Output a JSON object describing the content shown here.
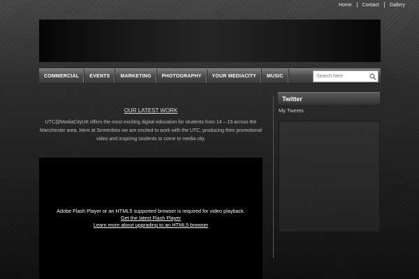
{
  "top_nav": {
    "home": "Home",
    "contact": "Contact",
    "gallery": "Gallery"
  },
  "main_nav": [
    "COMMERCIAL",
    "EVENTS",
    "MARKETING",
    "PHOTOGRAPHY",
    "YOUR MEDIACITY",
    "MUSIC"
  ],
  "search": {
    "placeholder": "Search here",
    "icon": "search-icon"
  },
  "content": {
    "heading": "OUR LATEST WORK",
    "body": "UTC@MediaCityUK offers the most exciting digital education for students from 14 – 19 across the Manchester area. Here at Screenboo we are excited to work with the UTC, producing their promotional video and inspiring students to come to media city."
  },
  "video": {
    "message": "Adobe Flash Player or an HTML5 supported browser is required for video playback.",
    "link1": "Get the latest Flash Player",
    "link2": "Learn more about upgrading to an HTML5 browser"
  },
  "sidebar": {
    "title": "Twitter",
    "my_tweets": "My Tweets"
  }
}
